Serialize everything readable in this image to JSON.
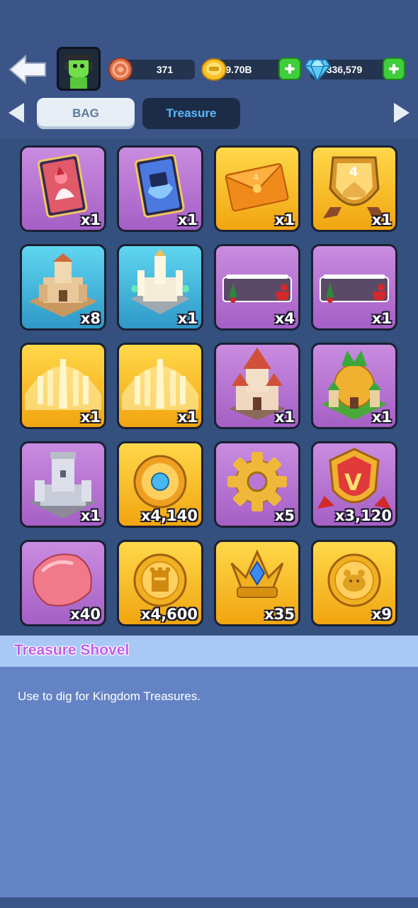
{
  "header": {
    "resources": [
      {
        "name": "tokens",
        "value": "371",
        "icon": "copper-token-icon"
      },
      {
        "name": "gold",
        "value": "9.70B",
        "icon": "gold-coin-icon"
      },
      {
        "name": "gems",
        "value": "336,579",
        "icon": "diamond-icon"
      }
    ]
  },
  "tabs": [
    {
      "label": "BAG",
      "active": false
    },
    {
      "label": "Treasure",
      "active": true
    }
  ],
  "items": [
    {
      "icon": "red-castle-card-icon",
      "qty": "x1",
      "bg": "purple"
    },
    {
      "icon": "blue-card-icon",
      "qty": "x1",
      "bg": "purple"
    },
    {
      "icon": "orange-envelope-icon",
      "qty": "x1",
      "bg": "gold"
    },
    {
      "icon": "level-4-shield-badge-icon",
      "qty": "x1",
      "bg": "gold"
    },
    {
      "icon": "sand-castle-icon",
      "qty": "x8",
      "bg": "teal"
    },
    {
      "icon": "crystal-castle-icon",
      "qty": "x1",
      "bg": "teal"
    },
    {
      "icon": "christmas-banner-icon",
      "qty": "x4",
      "bg": "purple"
    },
    {
      "icon": "christmas-banner-icon",
      "qty": "x1",
      "bg": "purple"
    },
    {
      "icon": "faded-crown-silhouette-icon",
      "qty": "x1",
      "bg": "gold"
    },
    {
      "icon": "faded-crown-silhouette-icon",
      "qty": "x1",
      "bg": "gold"
    },
    {
      "icon": "red-roof-castle-icon",
      "qty": "x1",
      "bg": "purple"
    },
    {
      "icon": "pineapple-castle-icon",
      "qty": "x1",
      "bg": "purple"
    },
    {
      "icon": "stone-tower-castle-icon",
      "qty": "x1",
      "bg": "purple"
    },
    {
      "icon": "compass-medal-icon",
      "qty": "x4,140",
      "bg": "gold"
    },
    {
      "icon": "gold-gear-icon",
      "qty": "x5",
      "bg": "purple"
    },
    {
      "icon": "v-shield-badge-icon",
      "qty": "x3,120",
      "bg": "purple"
    },
    {
      "icon": "pink-gem-stone-icon",
      "qty": "x40",
      "bg": "purple"
    },
    {
      "icon": "castle-coin-icon",
      "qty": "x4,600",
      "bg": "gold"
    },
    {
      "icon": "crown-trident-icon",
      "qty": "x35",
      "bg": "gold"
    },
    {
      "icon": "hamster-coin-icon",
      "qty": "x9",
      "bg": "gold"
    }
  ],
  "detail": {
    "title": "Treasure Shovel",
    "description": "Use to dig for Kingdom Treasures."
  },
  "colors": {
    "background": "#3b5588",
    "purple_tile": "#b876d6",
    "gold_tile": "#f8c22a",
    "teal_tile": "#45b8e0",
    "title_color": "#c25cf0",
    "panel": "#6483c4"
  }
}
